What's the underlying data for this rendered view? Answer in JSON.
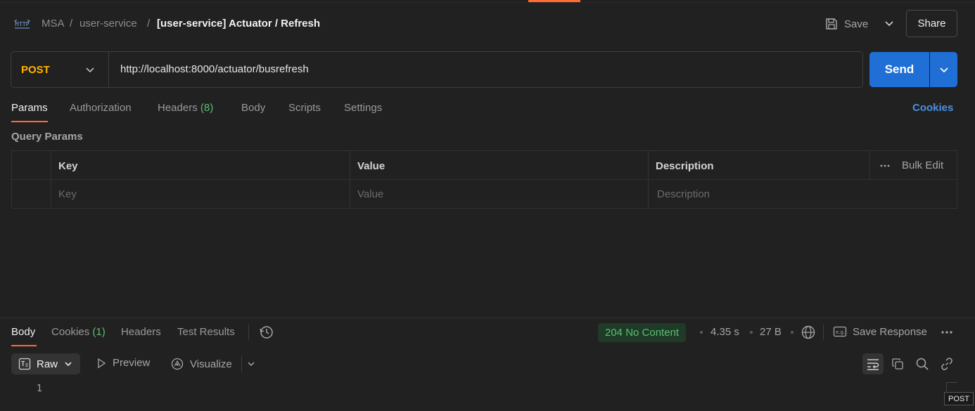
{
  "breadcrumb": {
    "icon": "http-icon",
    "workspace": "MSA",
    "separator": "/",
    "collection": "user-service",
    "request_title": "[user-service] Actuator / Refresh"
  },
  "header_actions": {
    "save_label": "Save",
    "share_label": "Share"
  },
  "request": {
    "method": "POST",
    "url": "http://localhost:8000/actuator/busrefresh",
    "send_label": "Send"
  },
  "request_tabs": [
    {
      "label": "Params",
      "active": true
    },
    {
      "label": "Authorization"
    },
    {
      "label": "Headers",
      "count": "(8)"
    },
    {
      "label": "Body"
    },
    {
      "label": "Scripts"
    },
    {
      "label": "Settings"
    }
  ],
  "cookies_link": "Cookies",
  "query_params": {
    "section_label": "Query Params",
    "headers": {
      "key": "Key",
      "value": "Value",
      "description": "Description"
    },
    "bulk_edit": "Bulk Edit",
    "placeholders": {
      "key": "Key",
      "value": "Value",
      "description": "Description"
    }
  },
  "response": {
    "tabs": [
      {
        "label": "Body",
        "active": true
      },
      {
        "label": "Cookies",
        "count": "(1)"
      },
      {
        "label": "Headers"
      },
      {
        "label": "Test Results"
      }
    ],
    "status": "204 No Content",
    "time": "4.35 s",
    "size": "27 B",
    "save_response": "Save Response",
    "format": "Raw",
    "preview_label": "Preview",
    "visualize_label": "Visualize",
    "line_numbers": [
      "1"
    ]
  },
  "tooltip": "POST",
  "colors": {
    "accent": "#ff6c37",
    "send": "#1f6fd6",
    "method": "#ffb400",
    "success": "#5bbf73",
    "link": "#4a90e2"
  }
}
